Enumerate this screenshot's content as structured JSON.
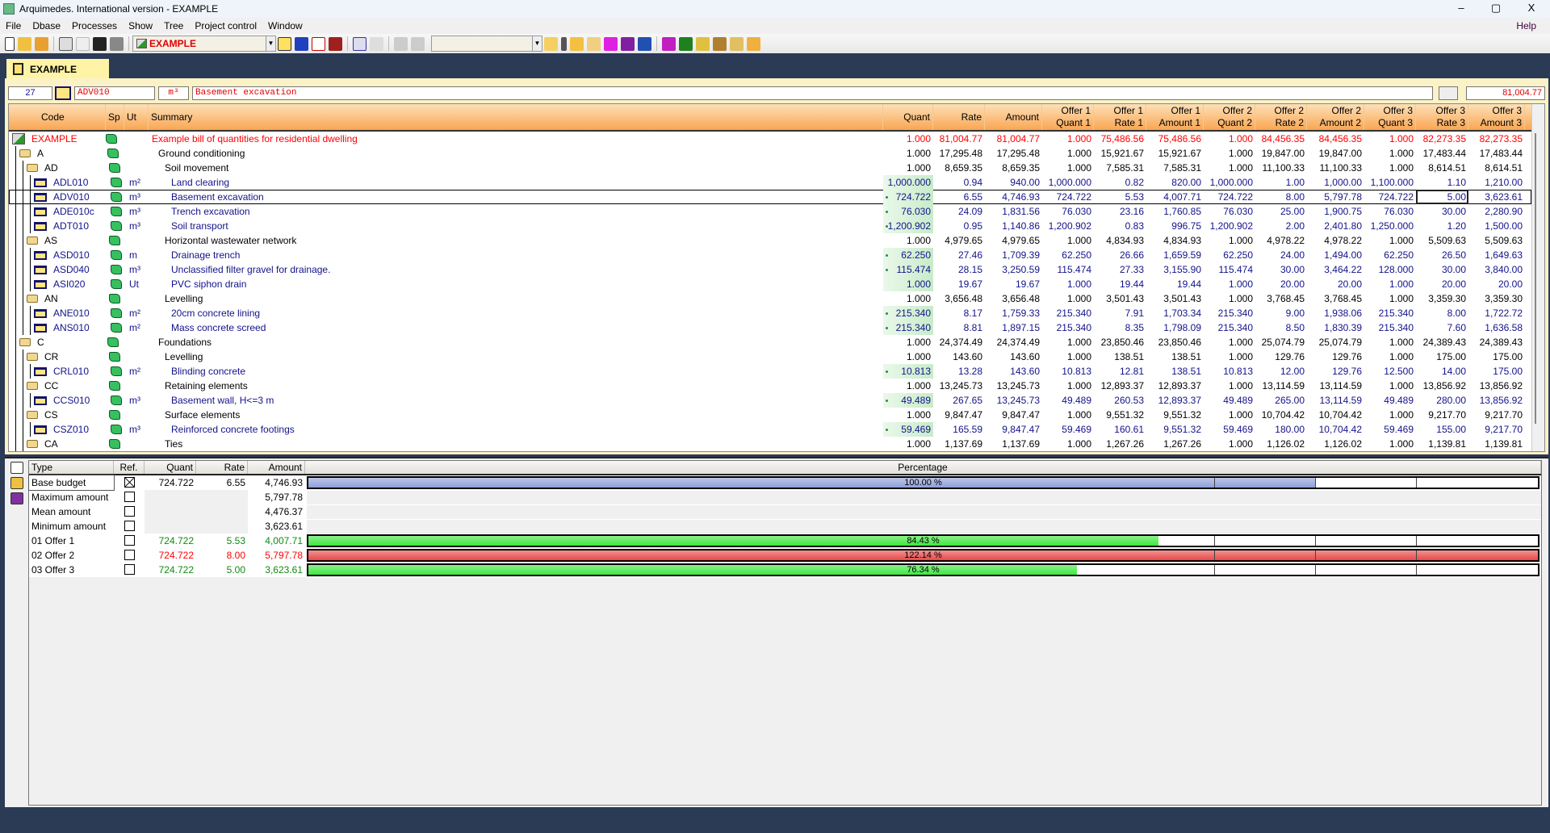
{
  "window": {
    "title": "Arquimedes. International version - EXAMPLE",
    "min": "–",
    "max": "▢",
    "close": "X"
  },
  "menu": {
    "items": [
      "File",
      "Dbase",
      "Processes",
      "Show",
      "Tree",
      "Project control",
      "Window"
    ],
    "help": "Help"
  },
  "toolbar": {
    "project_combo": "EXAMPLE",
    "second_combo": ""
  },
  "tab": {
    "label": "EXAMPLE"
  },
  "editor": {
    "number": "27",
    "code": "ADV010",
    "unit": "m³",
    "summary": "Basement excavation",
    "total": "81,004.77"
  },
  "grid": {
    "headers": {
      "code": "Code",
      "sp": "Sp",
      "ut": "Ut",
      "summary": "Summary",
      "numeric": [
        [
          "Quant",
          ""
        ],
        [
          "Rate",
          ""
        ],
        [
          "Amount",
          ""
        ],
        [
          "Offer 1",
          "Quant 1"
        ],
        [
          "Offer 1",
          "Rate 1"
        ],
        [
          "Offer 1",
          "Amount 1"
        ],
        [
          "Offer 2",
          "Quant 2"
        ],
        [
          "Offer 2",
          "Rate 2"
        ],
        [
          "Offer 2",
          "Amount 2"
        ],
        [
          "Offer 3",
          "Quant 3"
        ],
        [
          "Offer 3",
          "Rate 3"
        ],
        [
          "Offer 3",
          "Amount 3"
        ]
      ]
    },
    "selected_row": 4,
    "focused_cell": 10,
    "rows": [
      {
        "type": "root",
        "level": 0,
        "code": "EXAMPLE",
        "ut": "",
        "summary": "Example bill of quantities for residential dwelling",
        "measured": false,
        "cells": [
          "1.000",
          "81,004.77",
          "81,004.77",
          "1.000",
          "75,486.56",
          "75,486.56",
          "1.000",
          "84,456.35",
          "84,456.35",
          "1.000",
          "82,273.35",
          "82,273.35"
        ]
      },
      {
        "type": "chapter",
        "level": 1,
        "code": "A",
        "ut": "",
        "summary": "Ground conditioning",
        "measured": false,
        "cells": [
          "1.000",
          "17,295.48",
          "17,295.48",
          "1.000",
          "15,921.67",
          "15,921.67",
          "1.000",
          "19,847.00",
          "19,847.00",
          "1.000",
          "17,483.44",
          "17,483.44"
        ]
      },
      {
        "type": "chapter",
        "level": 2,
        "code": "AD",
        "ut": "",
        "summary": "Soil movement",
        "measured": false,
        "cells": [
          "1.000",
          "8,659.35",
          "8,659.35",
          "1.000",
          "7,585.31",
          "7,585.31",
          "1.000",
          "11,100.33",
          "11,100.33",
          "1.000",
          "8,614.51",
          "8,614.51"
        ]
      },
      {
        "type": "item",
        "level": 3,
        "code": "ADL010",
        "ut": "m²",
        "summary": "Land clearing",
        "measured": false,
        "cells": [
          "1,000.000",
          "0.94",
          "940.00",
          "1,000.000",
          "0.82",
          "820.00",
          "1,000.000",
          "1.00",
          "1,000.00",
          "1,100.000",
          "1.10",
          "1,210.00"
        ]
      },
      {
        "type": "item",
        "level": 3,
        "code": "ADV010",
        "ut": "m³",
        "summary": "Basement excavation",
        "measured": true,
        "cells": [
          "724.722",
          "6.55",
          "4,746.93",
          "724.722",
          "5.53",
          "4,007.71",
          "724.722",
          "8.00",
          "5,797.78",
          "724.722",
          "5.00",
          "3,623.61"
        ]
      },
      {
        "type": "item",
        "level": 3,
        "code": "ADE010c",
        "ut": "m³",
        "summary": "Trench excavation",
        "measured": true,
        "cells": [
          "76.030",
          "24.09",
          "1,831.56",
          "76.030",
          "23.16",
          "1,760.85",
          "76.030",
          "25.00",
          "1,900.75",
          "76.030",
          "30.00",
          "2,280.90"
        ]
      },
      {
        "type": "item",
        "level": 3,
        "code": "ADT010",
        "ut": "m³",
        "summary": "Soil transport",
        "measured": true,
        "cells": [
          "1,200.902",
          "0.95",
          "1,140.86",
          "1,200.902",
          "0.83",
          "996.75",
          "1,200.902",
          "2.00",
          "2,401.80",
          "1,250.000",
          "1.20",
          "1,500.00"
        ]
      },
      {
        "type": "chapter",
        "level": 2,
        "code": "AS",
        "ut": "",
        "summary": "Horizontal wastewater network",
        "measured": false,
        "cells": [
          "1.000",
          "4,979.65",
          "4,979.65",
          "1.000",
          "4,834.93",
          "4,834.93",
          "1.000",
          "4,978.22",
          "4,978.22",
          "1.000",
          "5,509.63",
          "5,509.63"
        ]
      },
      {
        "type": "item",
        "level": 3,
        "code": "ASD010",
        "ut": "m",
        "summary": "Drainage trench",
        "measured": true,
        "cells": [
          "62.250",
          "27.46",
          "1,709.39",
          "62.250",
          "26.66",
          "1,659.59",
          "62.250",
          "24.00",
          "1,494.00",
          "62.250",
          "26.50",
          "1,649.63"
        ]
      },
      {
        "type": "item",
        "level": 3,
        "code": "ASD040",
        "ut": "m³",
        "summary": "Unclassified filter gravel for drainage.",
        "measured": true,
        "cells": [
          "115.474",
          "28.15",
          "3,250.59",
          "115.474",
          "27.33",
          "3,155.90",
          "115.474",
          "30.00",
          "3,464.22",
          "128.000",
          "30.00",
          "3,840.00"
        ]
      },
      {
        "type": "item",
        "level": 3,
        "code": "ASI020",
        "ut": "Ut",
        "summary": "PVC siphon drain",
        "measured": false,
        "cells": [
          "1.000",
          "19.67",
          "19.67",
          "1.000",
          "19.44",
          "19.44",
          "1.000",
          "20.00",
          "20.00",
          "1.000",
          "20.00",
          "20.00"
        ]
      },
      {
        "type": "chapter",
        "level": 2,
        "code": "AN",
        "ut": "",
        "summary": "Levelling",
        "measured": false,
        "cells": [
          "1.000",
          "3,656.48",
          "3,656.48",
          "1.000",
          "3,501.43",
          "3,501.43",
          "1.000",
          "3,768.45",
          "3,768.45",
          "1.000",
          "3,359.30",
          "3,359.30"
        ]
      },
      {
        "type": "item",
        "level": 3,
        "code": "ANE010",
        "ut": "m²",
        "summary": "20cm concrete lining",
        "measured": true,
        "cells": [
          "215.340",
          "8.17",
          "1,759.33",
          "215.340",
          "7.91",
          "1,703.34",
          "215.340",
          "9.00",
          "1,938.06",
          "215.340",
          "8.00",
          "1,722.72"
        ]
      },
      {
        "type": "item",
        "level": 3,
        "code": "ANS010",
        "ut": "m²",
        "summary": "Mass concrete screed",
        "measured": true,
        "cells": [
          "215.340",
          "8.81",
          "1,897.15",
          "215.340",
          "8.35",
          "1,798.09",
          "215.340",
          "8.50",
          "1,830.39",
          "215.340",
          "7.60",
          "1,636.58"
        ]
      },
      {
        "type": "chapter",
        "level": 1,
        "code": "C",
        "ut": "",
        "summary": "Foundations",
        "measured": false,
        "cells": [
          "1.000",
          "24,374.49",
          "24,374.49",
          "1.000",
          "23,850.46",
          "23,850.46",
          "1.000",
          "25,074.79",
          "25,074.79",
          "1.000",
          "24,389.43",
          "24,389.43"
        ]
      },
      {
        "type": "chapter",
        "level": 2,
        "code": "CR",
        "ut": "",
        "summary": "Levelling",
        "measured": false,
        "cells": [
          "1.000",
          "143.60",
          "143.60",
          "1.000",
          "138.51",
          "138.51",
          "1.000",
          "129.76",
          "129.76",
          "1.000",
          "175.00",
          "175.00"
        ]
      },
      {
        "type": "item",
        "level": 3,
        "code": "CRL010",
        "ut": "m²",
        "summary": "Blinding concrete",
        "measured": true,
        "cells": [
          "10.813",
          "13.28",
          "143.60",
          "10.813",
          "12.81",
          "138.51",
          "10.813",
          "12.00",
          "129.76",
          "12.500",
          "14.00",
          "175.00"
        ]
      },
      {
        "type": "chapter",
        "level": 2,
        "code": "CC",
        "ut": "",
        "summary": "Retaining elements",
        "measured": false,
        "cells": [
          "1.000",
          "13,245.73",
          "13,245.73",
          "1.000",
          "12,893.37",
          "12,893.37",
          "1.000",
          "13,114.59",
          "13,114.59",
          "1.000",
          "13,856.92",
          "13,856.92"
        ]
      },
      {
        "type": "item",
        "level": 3,
        "code": "CCS010",
        "ut": "m³",
        "summary": "Basement wall, H<=3 m",
        "measured": true,
        "cells": [
          "49.489",
          "267.65",
          "13,245.73",
          "49.489",
          "260.53",
          "12,893.37",
          "49.489",
          "265.00",
          "13,114.59",
          "49.489",
          "280.00",
          "13,856.92"
        ]
      },
      {
        "type": "chapter",
        "level": 2,
        "code": "CS",
        "ut": "",
        "summary": "Surface elements",
        "measured": false,
        "cells": [
          "1.000",
          "9,847.47",
          "9,847.47",
          "1.000",
          "9,551.32",
          "9,551.32",
          "1.000",
          "10,704.42",
          "10,704.42",
          "1.000",
          "9,217.70",
          "9,217.70"
        ]
      },
      {
        "type": "item",
        "level": 3,
        "code": "CSZ010",
        "ut": "m³",
        "summary": "Reinforced concrete footings",
        "measured": true,
        "cells": [
          "59.469",
          "165.59",
          "9,847.47",
          "59.469",
          "160.61",
          "9,551.32",
          "59.469",
          "180.00",
          "10,704.42",
          "59.469",
          "155.00",
          "9,217.70"
        ]
      },
      {
        "type": "chapter",
        "level": 2,
        "code": "CA",
        "ut": "",
        "summary": "Ties",
        "measured": false,
        "cells": [
          "1.000",
          "1,137.69",
          "1,137.69",
          "1.000",
          "1,267.26",
          "1,267.26",
          "1.000",
          "1,126.02",
          "1,126.02",
          "1.000",
          "1,139.81",
          "1,139.81"
        ]
      }
    ]
  },
  "comparison": {
    "headers": {
      "type": "Type",
      "ref": "Ref.",
      "quant": "Quant",
      "rate": "Rate",
      "amount": "Amount",
      "percentage": "Percentage"
    },
    "scale_max_percent": 122.14,
    "markers_percent": [
      90,
      100,
      110
    ],
    "rows": [
      {
        "type": "Base budget",
        "ref": true,
        "quant": "724.722",
        "rate": "6.55",
        "amount": "4,746.93",
        "percent": 100.0,
        "percent_label": "100.00 %",
        "bar_color": "#8f9fd8",
        "text_color": "#000000"
      },
      {
        "type": "Maximum amount",
        "ref": false,
        "quant": "",
        "rate": "",
        "amount": "5,797.78",
        "percent": null,
        "percent_label": "",
        "bar_color": "",
        "text_color": "#000000"
      },
      {
        "type": "Mean amount",
        "ref": false,
        "quant": "",
        "rate": "",
        "amount": "4,476.37",
        "percent": null,
        "percent_label": "",
        "bar_color": "",
        "text_color": "#000000"
      },
      {
        "type": "Minimum amount",
        "ref": false,
        "quant": "",
        "rate": "",
        "amount": "3,623.61",
        "percent": null,
        "percent_label": "",
        "bar_color": "",
        "text_color": "#000000"
      },
      {
        "type": "01 Offer 1",
        "ref": false,
        "quant": "724.722",
        "rate": "5.53",
        "amount": "4,007.71",
        "percent": 84.43,
        "percent_label": "84.43 %",
        "bar_color": "#3ee83e",
        "text_color": "#108a10"
      },
      {
        "type": "02 Offer 2",
        "ref": false,
        "quant": "724.722",
        "rate": "8.00",
        "amount": "5,797.78",
        "percent": 122.14,
        "percent_label": "122.14 %",
        "bar_color": "#e84848",
        "text_color": "#ff0000"
      },
      {
        "type": "03 Offer 3",
        "ref": false,
        "quant": "724.722",
        "rate": "5.00",
        "amount": "3,623.61",
        "percent": 76.34,
        "percent_label": "76.34 %",
        "bar_color": "#3ee83e",
        "text_color": "#108a10"
      }
    ]
  },
  "colors": {
    "root": "#ff0000",
    "chapter": "#000000",
    "item": "#12128a",
    "accent": "#f9a653",
    "background": "#2b3a55"
  }
}
